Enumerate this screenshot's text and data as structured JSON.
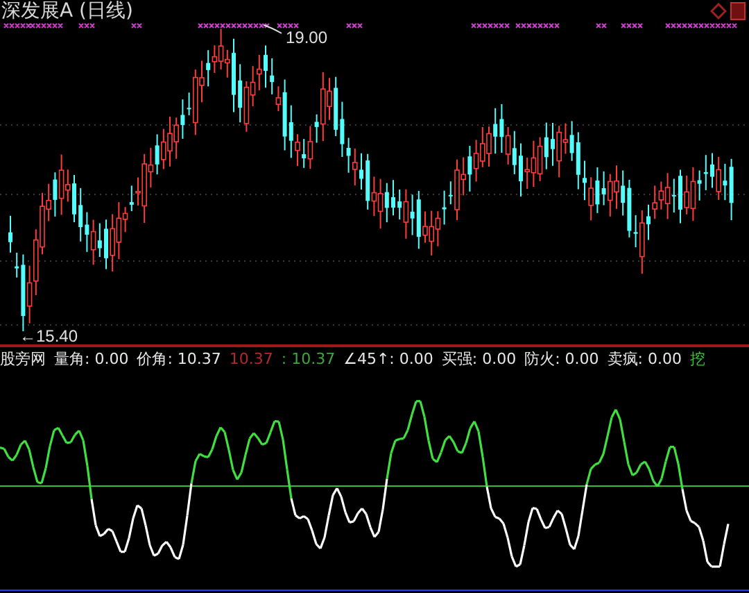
{
  "title": "深发展A (日线)",
  "price_chart": {
    "high_label": "19.00",
    "low_label": "←15.40"
  },
  "indicator": {
    "name": "股旁网",
    "items": [
      {
        "text": "量角: 0.00",
        "color": "#e8e8e8"
      },
      {
        "text": "价角: 10.37",
        "color": "#e8e8e8"
      },
      {
        "text": "10.37",
        "color": "#b02a2a"
      },
      {
        "text": ": 10.37",
        "color": "#3fa63f"
      },
      {
        "text": "∠45↑: 0.00",
        "color": "#e8e8e8"
      },
      {
        "text": "买强: 0.00",
        "color": "#e8e8e8"
      },
      {
        "text": "防火: 0.00",
        "color": "#e8e8e8"
      },
      {
        "text": "卖疯: 0.00",
        "color": "#e8e8e8"
      },
      {
        "text": "挖",
        "color": "#33cc33"
      }
    ]
  }
}
